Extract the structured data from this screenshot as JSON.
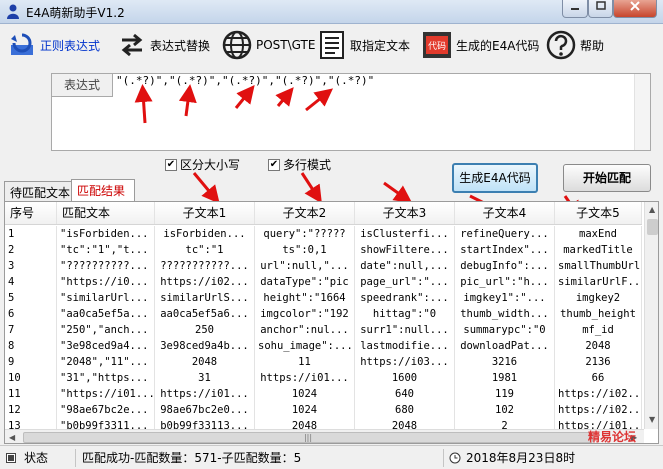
{
  "window": {
    "title": "E4A萌新助手V1.2"
  },
  "toolbar": {
    "items": [
      {
        "label": "正则表达式",
        "icon": "regex-refresh-icon",
        "active": true
      },
      {
        "label": "表达式替换",
        "icon": "swap-arrows-icon"
      },
      {
        "label": "POST\\GTE",
        "icon": "globe-icon"
      },
      {
        "label": "取指定文本",
        "icon": "document-list-icon"
      },
      {
        "label": "生成的E4A代码",
        "icon": "code-book-icon",
        "badge": "代码"
      },
      {
        "label": "帮助",
        "icon": "help-icon"
      }
    ]
  },
  "expression": {
    "label": "表达式",
    "value": "\"(.*?)\",\"(.*?)\",\"(.*?)\",\"(.*?)\",\"(.*?)\""
  },
  "options": {
    "case_sensitive": {
      "label": "区分大小写",
      "checked": true
    },
    "multiline": {
      "label": "多行模式",
      "checked": true
    }
  },
  "buttons": {
    "generate": "生成E4A代码",
    "start": "开始匹配"
  },
  "tabs": [
    {
      "label": "待匹配文本",
      "active": false
    },
    {
      "label": "匹配结果",
      "active": true
    }
  ],
  "table": {
    "columns": [
      "序号",
      "匹配文本",
      "子文本1",
      "子文本2",
      "子文本3",
      "子文本4",
      "子文本5"
    ],
    "rows": [
      [
        "1",
        "\"isForbiden...",
        "isForbiden...",
        "query\":\"?????",
        "isClusterfi...",
        "refineQuery...",
        "maxEnd"
      ],
      [
        "2",
        "\"tc\":\"1\",\"t...",
        "tc\":\"1",
        "ts\":0,1",
        "showFiltere...",
        "startIndex\"...",
        "markedTitle"
      ],
      [
        "3",
        "\"??????????...",
        "???????????...",
        "url\":null,\"...",
        "date\":null,...",
        "debugInfo\":...",
        "smallThumbUrl"
      ],
      [
        "4",
        "\"https://i0...",
        "https://i02...",
        "dataType\":\"pic",
        "page_url\":\"...",
        "pic_url\":\"h...",
        "similarUrlF..."
      ],
      [
        "5",
        "\"similarUrl...",
        "similarUrlS...",
        "height\":\"1664",
        "speedrank\":...",
        "imgkey1\":\"...",
        "imgkey2"
      ],
      [
        "6",
        "\"aa0ca5ef5a...",
        "aa0ca5ef5a6...",
        "imgcolor\":\"192",
        "hittag\":\"0",
        "thumb_width...",
        "thumb_height"
      ],
      [
        "7",
        "\"250\",\"anch...",
        "250",
        "anchor\":nul...",
        "surr1\":null...",
        "summarypc\":\"0",
        "mf_id"
      ],
      [
        "8",
        "\"3e98ced9a4...",
        "3e98ced9a4b...",
        "sohu_image\":...",
        "lastmodifie...",
        "downloadPat...",
        "2048"
      ],
      [
        "9",
        "\"2048\",\"11\"...",
        "2048",
        "11",
        "https://i03...",
        "3216",
        "2136"
      ],
      [
        "10",
        "\"31\",\"https...",
        "31",
        "https://i01...",
        "1600",
        "1981",
        "66"
      ],
      [
        "11",
        "\"https://i01...",
        "https://i01...",
        "1024",
        "640",
        "119",
        "https://i02..."
      ],
      [
        "12",
        "\"98ae67bc2e...",
        "98ae67bc2e0...",
        "1024",
        "680",
        "102",
        "https://i02..."
      ],
      [
        "13",
        "\"b0b99f3311...",
        "b0b99f33113...",
        "2048",
        "2048",
        "2",
        "https://i01..."
      ]
    ]
  },
  "status": {
    "label": "状态",
    "message": "匹配成功-匹配数量：571-子匹配数量：5",
    "datetime": "2018年8月23日8时",
    "watermark": "精易论坛"
  }
}
